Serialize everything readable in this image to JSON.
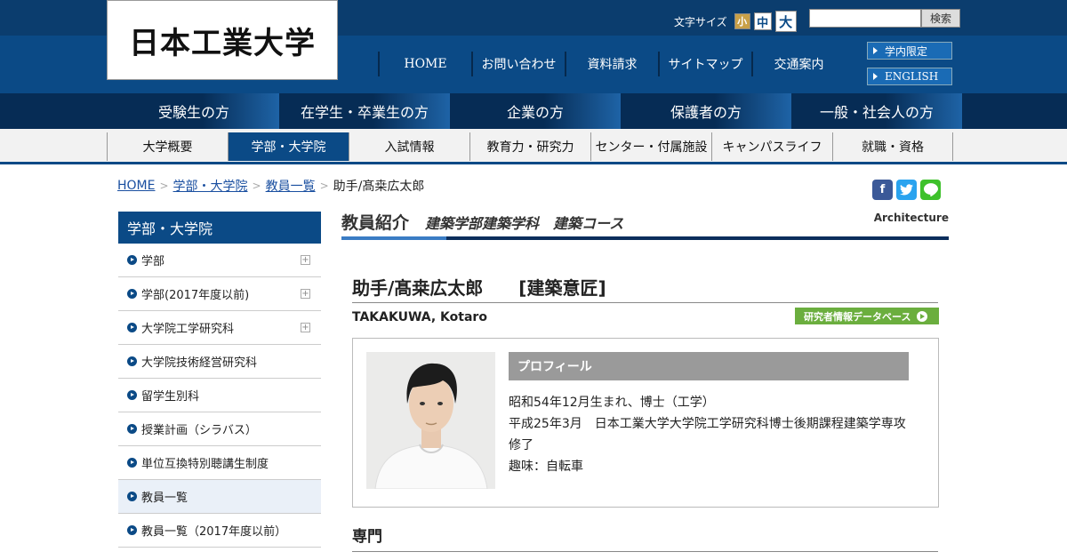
{
  "header": {
    "logo_text": "日本工業大学",
    "font_size_label": "文字サイズ",
    "font_sizes": [
      "小",
      "中",
      "大"
    ],
    "search_placeholder": "",
    "search_button": "検索",
    "top_nav": [
      "HOME",
      "お問い合わせ",
      "資料請求",
      "サイトマップ",
      "交通案内"
    ],
    "side_buttons": [
      "学内限定",
      "ENGLISH"
    ]
  },
  "audience_nav": [
    "受験生の方",
    "在学生・卒業生の方",
    "企業の方",
    "保護者の方",
    "一般・社会人の方"
  ],
  "main_nav": {
    "items": [
      "大学概要",
      "学部・大学院",
      "入試情報",
      "教育力・研究力",
      "センター・付属施設",
      "キャンパスライフ",
      "就職・資格"
    ],
    "active": "学部・大学院"
  },
  "breadcrumb": {
    "links": [
      "HOME",
      "学部・大学院",
      "教員一覧"
    ],
    "current": "助手/髙桒広太郎"
  },
  "social": [
    "f",
    "t",
    "L"
  ],
  "sidebar": {
    "title": "学部・大学院",
    "items": [
      {
        "label": "学部",
        "expand": "+"
      },
      {
        "label": "学部(2017年度以前)",
        "expand": "+"
      },
      {
        "label": "大学院工学研究科",
        "expand": "+"
      },
      {
        "label": "大学院技術経営研究科",
        "expand": ""
      },
      {
        "label": "留学生別科",
        "expand": ""
      },
      {
        "label": "授業計画（シラバス）",
        "expand": ""
      },
      {
        "label": "単位互換特別聴講生制度",
        "expand": ""
      },
      {
        "label": "教員一覧",
        "expand": ""
      },
      {
        "label": "教員一覧（2017年度以前）",
        "expand": ""
      }
    ],
    "active": "教員一覧"
  },
  "page": {
    "title": "教員紹介",
    "subtitle": "建築学部建築学科　建築コース",
    "tag": "Architecture",
    "name": "助手/髙桒広太郎　　[建築意匠]",
    "romaji": "TAKAKUWA, Kotaro",
    "db_button": "研究者情報データベース",
    "profile_heading": "プロフィール",
    "profile_lines": [
      "昭和54年12月生まれ、博士（工学）",
      "平成25年3月　日本工業大学大学院工学研究科博士後期課程建築学専攻",
      "修了",
      "趣味：自転車"
    ],
    "section_heading": "専門"
  },
  "colors": {
    "navy": "#0b4a86",
    "dark_navy": "#062c55",
    "green": "#6bae3e",
    "facebook": "#3b5998",
    "twitter": "#2aa3ef",
    "line": "#3ec12b"
  }
}
